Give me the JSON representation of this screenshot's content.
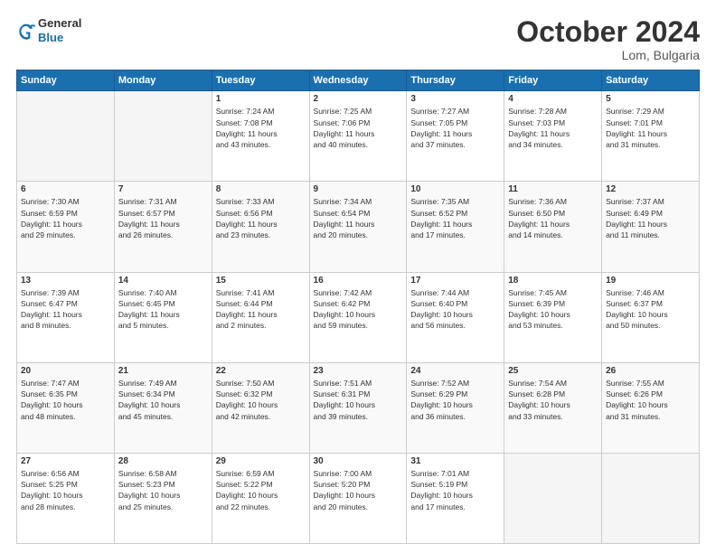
{
  "header": {
    "logo_general": "General",
    "logo_blue": "Blue",
    "title": "October 2024",
    "location": "Lom, Bulgaria"
  },
  "days_of_week": [
    "Sunday",
    "Monday",
    "Tuesday",
    "Wednesday",
    "Thursday",
    "Friday",
    "Saturday"
  ],
  "weeks": [
    [
      {
        "day": "",
        "info": ""
      },
      {
        "day": "",
        "info": ""
      },
      {
        "day": "1",
        "info": "Sunrise: 7:24 AM\nSunset: 7:08 PM\nDaylight: 11 hours\nand 43 minutes."
      },
      {
        "day": "2",
        "info": "Sunrise: 7:25 AM\nSunset: 7:06 PM\nDaylight: 11 hours\nand 40 minutes."
      },
      {
        "day": "3",
        "info": "Sunrise: 7:27 AM\nSunset: 7:05 PM\nDaylight: 11 hours\nand 37 minutes."
      },
      {
        "day": "4",
        "info": "Sunrise: 7:28 AM\nSunset: 7:03 PM\nDaylight: 11 hours\nand 34 minutes."
      },
      {
        "day": "5",
        "info": "Sunrise: 7:29 AM\nSunset: 7:01 PM\nDaylight: 11 hours\nand 31 minutes."
      }
    ],
    [
      {
        "day": "6",
        "info": "Sunrise: 7:30 AM\nSunset: 6:59 PM\nDaylight: 11 hours\nand 29 minutes."
      },
      {
        "day": "7",
        "info": "Sunrise: 7:31 AM\nSunset: 6:57 PM\nDaylight: 11 hours\nand 26 minutes."
      },
      {
        "day": "8",
        "info": "Sunrise: 7:33 AM\nSunset: 6:56 PM\nDaylight: 11 hours\nand 23 minutes."
      },
      {
        "day": "9",
        "info": "Sunrise: 7:34 AM\nSunset: 6:54 PM\nDaylight: 11 hours\nand 20 minutes."
      },
      {
        "day": "10",
        "info": "Sunrise: 7:35 AM\nSunset: 6:52 PM\nDaylight: 11 hours\nand 17 minutes."
      },
      {
        "day": "11",
        "info": "Sunrise: 7:36 AM\nSunset: 6:50 PM\nDaylight: 11 hours\nand 14 minutes."
      },
      {
        "day": "12",
        "info": "Sunrise: 7:37 AM\nSunset: 6:49 PM\nDaylight: 11 hours\nand 11 minutes."
      }
    ],
    [
      {
        "day": "13",
        "info": "Sunrise: 7:39 AM\nSunset: 6:47 PM\nDaylight: 11 hours\nand 8 minutes."
      },
      {
        "day": "14",
        "info": "Sunrise: 7:40 AM\nSunset: 6:45 PM\nDaylight: 11 hours\nand 5 minutes."
      },
      {
        "day": "15",
        "info": "Sunrise: 7:41 AM\nSunset: 6:44 PM\nDaylight: 11 hours\nand 2 minutes."
      },
      {
        "day": "16",
        "info": "Sunrise: 7:42 AM\nSunset: 6:42 PM\nDaylight: 10 hours\nand 59 minutes."
      },
      {
        "day": "17",
        "info": "Sunrise: 7:44 AM\nSunset: 6:40 PM\nDaylight: 10 hours\nand 56 minutes."
      },
      {
        "day": "18",
        "info": "Sunrise: 7:45 AM\nSunset: 6:39 PM\nDaylight: 10 hours\nand 53 minutes."
      },
      {
        "day": "19",
        "info": "Sunrise: 7:46 AM\nSunset: 6:37 PM\nDaylight: 10 hours\nand 50 minutes."
      }
    ],
    [
      {
        "day": "20",
        "info": "Sunrise: 7:47 AM\nSunset: 6:35 PM\nDaylight: 10 hours\nand 48 minutes."
      },
      {
        "day": "21",
        "info": "Sunrise: 7:49 AM\nSunset: 6:34 PM\nDaylight: 10 hours\nand 45 minutes."
      },
      {
        "day": "22",
        "info": "Sunrise: 7:50 AM\nSunset: 6:32 PM\nDaylight: 10 hours\nand 42 minutes."
      },
      {
        "day": "23",
        "info": "Sunrise: 7:51 AM\nSunset: 6:31 PM\nDaylight: 10 hours\nand 39 minutes."
      },
      {
        "day": "24",
        "info": "Sunrise: 7:52 AM\nSunset: 6:29 PM\nDaylight: 10 hours\nand 36 minutes."
      },
      {
        "day": "25",
        "info": "Sunrise: 7:54 AM\nSunset: 6:28 PM\nDaylight: 10 hours\nand 33 minutes."
      },
      {
        "day": "26",
        "info": "Sunrise: 7:55 AM\nSunset: 6:26 PM\nDaylight: 10 hours\nand 31 minutes."
      }
    ],
    [
      {
        "day": "27",
        "info": "Sunrise: 6:56 AM\nSunset: 5:25 PM\nDaylight: 10 hours\nand 28 minutes."
      },
      {
        "day": "28",
        "info": "Sunrise: 6:58 AM\nSunset: 5:23 PM\nDaylight: 10 hours\nand 25 minutes."
      },
      {
        "day": "29",
        "info": "Sunrise: 6:59 AM\nSunset: 5:22 PM\nDaylight: 10 hours\nand 22 minutes."
      },
      {
        "day": "30",
        "info": "Sunrise: 7:00 AM\nSunset: 5:20 PM\nDaylight: 10 hours\nand 20 minutes."
      },
      {
        "day": "31",
        "info": "Sunrise: 7:01 AM\nSunset: 5:19 PM\nDaylight: 10 hours\nand 17 minutes."
      },
      {
        "day": "",
        "info": ""
      },
      {
        "day": "",
        "info": ""
      }
    ]
  ]
}
